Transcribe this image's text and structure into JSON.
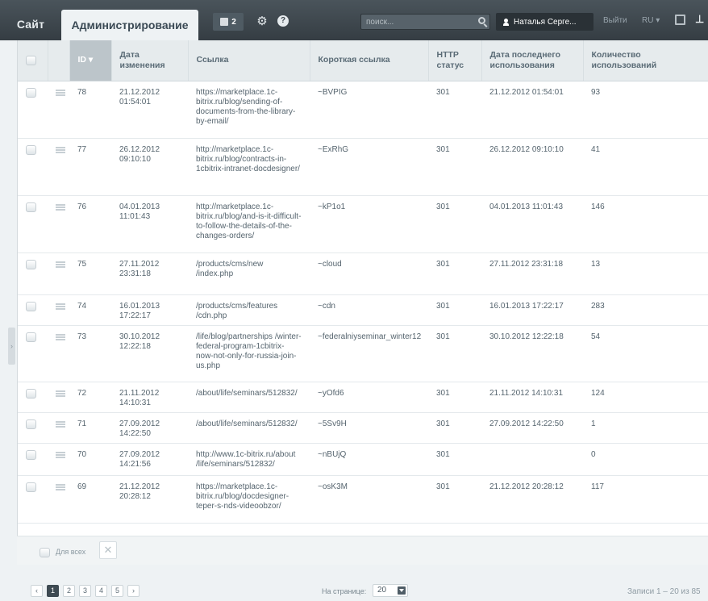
{
  "topbar": {
    "site": "Сайт",
    "admin": "Администрирование",
    "notifications": "2",
    "search_placeholder": "поиск...",
    "user": "Наталья Серге...",
    "logout": "Выйти",
    "lang": "RU"
  },
  "table": {
    "headers": {
      "id": "ID",
      "date": "Дата изменения",
      "link": "Ссылка",
      "short": "Короткая ссылка",
      "http": "HTTP статус",
      "last": "Дата последнего использования",
      "count": "Количество использований"
    },
    "rows": [
      {
        "id": "78",
        "date": "21.12.2012 01:54:01",
        "link": "https://marketplace.1c-bitrix.ru/blog/sending-of-documents-from-the-library-by-email/",
        "short": "~BVPIG",
        "http": "301",
        "last": "21.12.2012 01:54:01",
        "count": "93"
      },
      {
        "id": "77",
        "date": "26.12.2012 09:10:10",
        "link": "http://marketplace.1c-bitrix.ru/blog/contracts-in-1cbitrix-intranet-docdesigner/",
        "short": "~ExRhG",
        "http": "301",
        "last": "26.12.2012 09:10:10",
        "count": "41"
      },
      {
        "id": "76",
        "date": "04.01.2013 11:01:43",
        "link": "http://marketplace.1c-bitrix.ru/blog/and-is-it-difficult-to-follow-the-details-of-the-changes-orders/",
        "short": "~kP1o1",
        "http": "301",
        "last": "04.01.2013 11:01:43",
        "count": "146"
      },
      {
        "id": "75",
        "date": "27.11.2012 23:31:18",
        "link": "/products/cms/new /index.php",
        "short": "~cloud",
        "http": "301",
        "last": "27.11.2012 23:31:18",
        "count": "13"
      },
      {
        "id": "74",
        "date": "16.01.2013 17:22:17",
        "link": "/products/cms/features /cdn.php",
        "short": "~cdn",
        "http": "301",
        "last": "16.01.2013 17:22:17",
        "count": "283"
      },
      {
        "id": "73",
        "date": "30.10.2012 12:22:18",
        "link": "/life/blog/partnerships /winter-federal-program-1cbitrix-now-not-only-for-russia-join-us.php",
        "short": "~federalniyseminar_winter12",
        "http": "301",
        "last": "30.10.2012 12:22:18",
        "count": "54"
      },
      {
        "id": "72",
        "date": "21.11.2012 14:10:31",
        "link": "/about/life/seminars/512832/",
        "short": "~yOfd6",
        "http": "301",
        "last": "21.11.2012 14:10:31",
        "count": "124"
      },
      {
        "id": "71",
        "date": "27.09.2012 14:22:50",
        "link": "/about/life/seminars/512832/",
        "short": "~5Sv9H",
        "http": "301",
        "last": "27.09.2012 14:22:50",
        "count": "1"
      },
      {
        "id": "70",
        "date": "27.09.2012 14:21:56",
        "link": "http://www.1c-bitrix.ru/about /life/seminars/512832/",
        "short": "~nBUjQ",
        "http": "301",
        "last": "",
        "count": "0"
      },
      {
        "id": "69",
        "date": "21.12.2012 20:28:12",
        "link": "https://marketplace.1c-bitrix.ru/blog/docdesigner-teper-s-nds-videoobzor/",
        "short": "~osK3M",
        "http": "301",
        "last": "21.12.2012 20:28:12",
        "count": "117"
      }
    ]
  },
  "footer": {
    "for_all": "Для всех",
    "pages": [
      "1",
      "2",
      "3",
      "4",
      "5"
    ],
    "per_page_label": "На странице:",
    "per_page_value": "20",
    "records": "Записи 1 – 20 из 85"
  }
}
